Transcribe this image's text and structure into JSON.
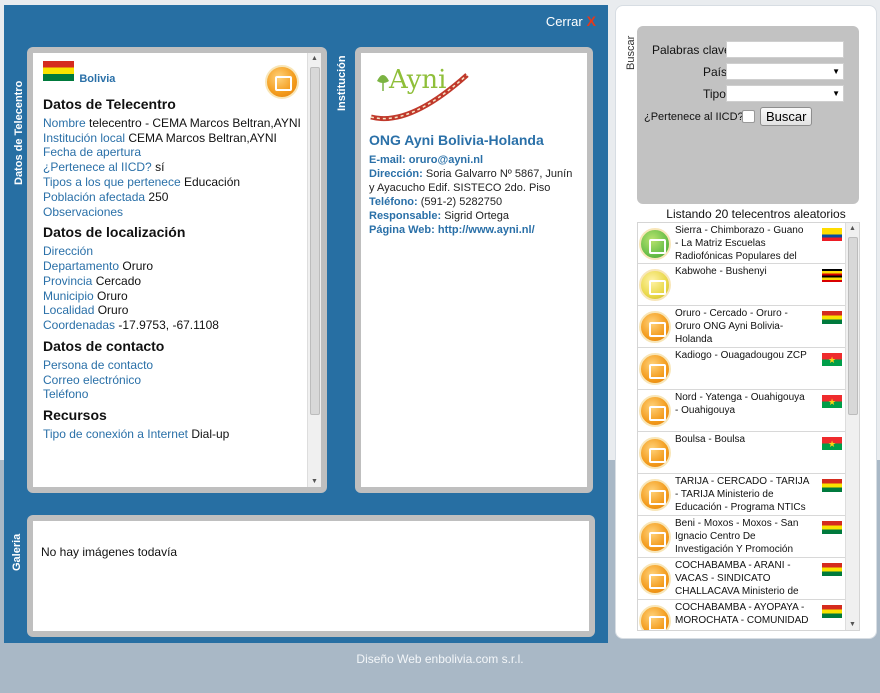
{
  "main": {
    "close_label": "Cerrar",
    "close_x": "X",
    "vertical_labels": {
      "datos": "Datos de Telecentro",
      "institucion": "Institución",
      "galeria": "Galeria"
    }
  },
  "datos": {
    "country": "Bolivia",
    "sections": {
      "telecentro": "Datos de Telecentro",
      "localizacion": "Datos de localización",
      "contacto": "Datos de contacto",
      "recursos": "Recursos"
    },
    "fields": {
      "nombre_label": "Nombre",
      "nombre_value": "telecentro - CEMA Marcos Beltran,AYNI",
      "institucion_label": "Institución local",
      "institucion_value": "CEMA Marcos Beltran,AYNI",
      "fecha_label": "Fecha de apertura",
      "iicd_label": "¿Pertenece al IICD?",
      "iicd_value": "sí",
      "tipos_label": "Tipos a los que pertenece",
      "tipos_value": "Educación",
      "poblacion_label": "Población afectada",
      "poblacion_value": "250",
      "observaciones_label": "Observaciones",
      "direccion_label": "Dirección",
      "departamento_label": "Departamento",
      "departamento_value": "Oruro",
      "provincia_label": "Provincia",
      "provincia_value": "Cercado",
      "municipio_label": "Municipio",
      "municipio_value": "Oruro",
      "localidad_label": "Localidad",
      "localidad_value": "Oruro",
      "coordenadas_label": "Coordenadas",
      "coordenadas_value": "-17.9753, -67.1108",
      "persona_label": "Persona de contacto",
      "correo_label": "Correo electrónico",
      "telefono_label": "Teléfono",
      "conexion_label": "Tipo de conexión a Internet",
      "conexion_value": "Dial-up"
    }
  },
  "institucion": {
    "logo_text": "Ayni",
    "name": "ONG Ayni Bolivia-Holanda",
    "email_label": "E-mail:",
    "email_value": "oruro@ayni.nl",
    "direccion_label": "Dirección:",
    "direccion_value": "Soria Galvarro Nº 5867, Junín y Ayacucho Edif. SISTECO 2do. Piso",
    "telefono_label": "Teléfono:",
    "telefono_value": "(591-2) 5282750",
    "responsable_label": "Responsable:",
    "responsable_value": "Sigrid Ortega",
    "web_label": "Página Web:",
    "web_value": "http://www.ayni.nl/"
  },
  "galeria": {
    "empty_text": "No hay imágenes todavía"
  },
  "search": {
    "vertical_label": "Buscar",
    "keywords_label": "Palabras clave",
    "keywords_value": "",
    "pais_label": "País",
    "pais_value": "",
    "tipo_label": "Tipo",
    "tipo_value": "",
    "iicd_label": "¿Pertenece al IICD?",
    "button_label": "Buscar"
  },
  "list": {
    "title": "Listando 20 telecentros aleatorios",
    "items": [
      {
        "text": "Sierra - Chimborazo - Guano - La Matriz Escuelas Radiofónicas Populares del",
        "flag": "ec",
        "icon": "green"
      },
      {
        "text": "Kabwohe - Bushenyi",
        "flag": "ug",
        "icon": "yellow"
      },
      {
        "text": "Oruro - Cercado - Oruro - Oruro ONG Ayni Bolivia-Holanda",
        "flag": "bo",
        "icon": "orange"
      },
      {
        "text": "Kadiogo - Ouagadougou ZCP",
        "flag": "bf",
        "icon": "orange"
      },
      {
        "text": "Nord - Yatenga - Ouahigouya - Ouahigouya",
        "flag": "bf",
        "icon": "orange"
      },
      {
        "text": "Boulsa - Boulsa",
        "flag": "bf",
        "icon": "orange"
      },
      {
        "text": "TARIJA - CERCADO - TARIJA - TARIJA Ministerio de Educación - Programa NTICs",
        "flag": "bo",
        "icon": "orange"
      },
      {
        "text": "Beni - Moxos - Moxos - San Ignacio Centro De Investigación Y Promoción",
        "flag": "bo",
        "icon": "orange"
      },
      {
        "text": "COCHABAMBA - ARANI - VACAS - SINDICATO CHALLACAVA Ministerio de",
        "flag": "bo",
        "icon": "orange"
      },
      {
        "text": "COCHABAMBA - AYOPAYA - MOROCHATA - COMUNIDAD",
        "flag": "bo",
        "icon": "orange"
      }
    ]
  },
  "footer": {
    "text": "Diseño Web enbolivia.com s.r.l."
  }
}
